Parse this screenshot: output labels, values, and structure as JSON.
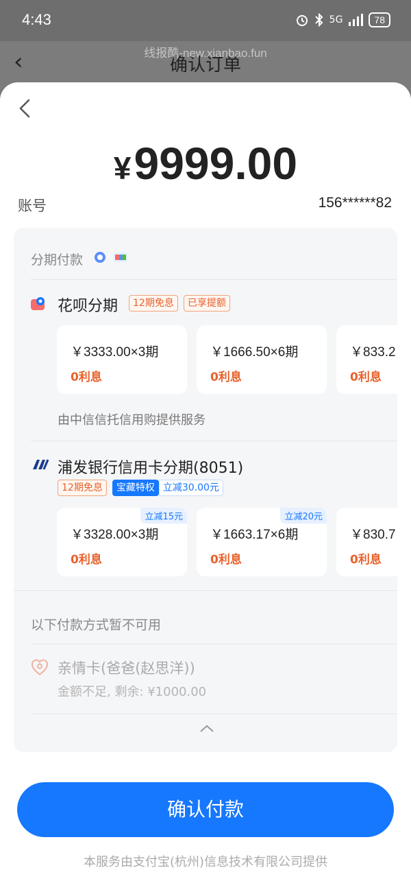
{
  "status": {
    "time": "4:43",
    "network": "5G",
    "battery": "78"
  },
  "underlying": {
    "title": "确认订单",
    "watermark": "线报酷-new.xianbao.fun"
  },
  "amount": {
    "currency": "¥",
    "value": "9999.00"
  },
  "account": {
    "label": "账号",
    "value": "156******82"
  },
  "installment_section": {
    "title": "分期付款"
  },
  "huabei": {
    "name": "花呗分期",
    "tags": [
      "12期免息",
      "已享提额"
    ],
    "plans": [
      {
        "amount": "￥3333.00×3期",
        "interest": "0利息"
      },
      {
        "amount": "￥1666.50×6期",
        "interest": "0利息"
      },
      {
        "amount": "￥833.2",
        "interest": "0利息"
      }
    ],
    "provider": "由中信信托信用购提供服务"
  },
  "spdb": {
    "name": "浦发银行信用卡分期(8051)",
    "tags": [
      "12期免息",
      "宝藏特权",
      "立减30.00元"
    ],
    "plans": [
      {
        "amount": "￥3328.00×3期",
        "interest": "0利息",
        "badge": "立减15元"
      },
      {
        "amount": "￥1663.17×6期",
        "interest": "0利息",
        "badge": "立减20元"
      },
      {
        "amount": "￥830.7",
        "interest": "0利息"
      }
    ]
  },
  "unavailable": {
    "title": "以下付款方式暂不可用",
    "kinship_card": {
      "name": "亲情卡(爸爸(赵思洋))",
      "note": "金额不足, 剩余: ¥1000.00"
    }
  },
  "confirm_button": "确认付款",
  "footer": "本服务由支付宝(杭州)信息技术有限公司提供",
  "colors": {
    "primary": "#1677ff",
    "orange": "#e8612b",
    "panel_bg": "#f5f6f8"
  }
}
